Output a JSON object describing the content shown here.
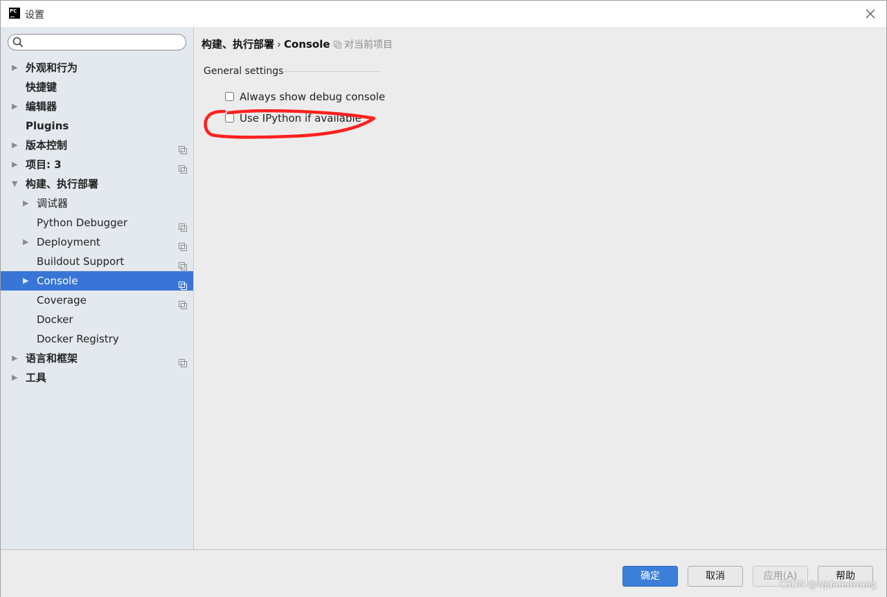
{
  "window": {
    "title": "设置",
    "app_icon_text": "PC"
  },
  "search": {
    "placeholder": "",
    "value": ""
  },
  "sidebar": {
    "items": [
      {
        "label": "外观和行为"
      },
      {
        "label": "快捷键"
      },
      {
        "label": "编辑器"
      },
      {
        "label": "Plugins"
      },
      {
        "label": "版本控制"
      },
      {
        "label": "项目: 3"
      },
      {
        "label": "构建、执行部署"
      },
      {
        "label": "调试器"
      },
      {
        "label": "Python Debugger"
      },
      {
        "label": "Deployment"
      },
      {
        "label": "Buildout Support"
      },
      {
        "label": "Console"
      },
      {
        "label": "Coverage"
      },
      {
        "label": "Docker"
      },
      {
        "label": "Docker Registry"
      },
      {
        "label": "语言和框架"
      },
      {
        "label": "工具"
      }
    ]
  },
  "breadcrumb": {
    "parent": "构建、执行部署",
    "separator": "›",
    "current": "Console",
    "scope": "对当前项目"
  },
  "main": {
    "section_title": "General settings",
    "options": [
      {
        "label": "Always show debug console",
        "checked": false
      },
      {
        "label": "Use IPython if available",
        "checked": false
      }
    ]
  },
  "buttons": {
    "ok": "确定",
    "cancel": "取消",
    "apply": "应用(A)",
    "help": "帮助"
  },
  "watermark": "CSDN @wjdamowang",
  "colors": {
    "selection": "#3875d7",
    "primary_button": "#3c7fd8",
    "annotation": "#ff2020"
  }
}
